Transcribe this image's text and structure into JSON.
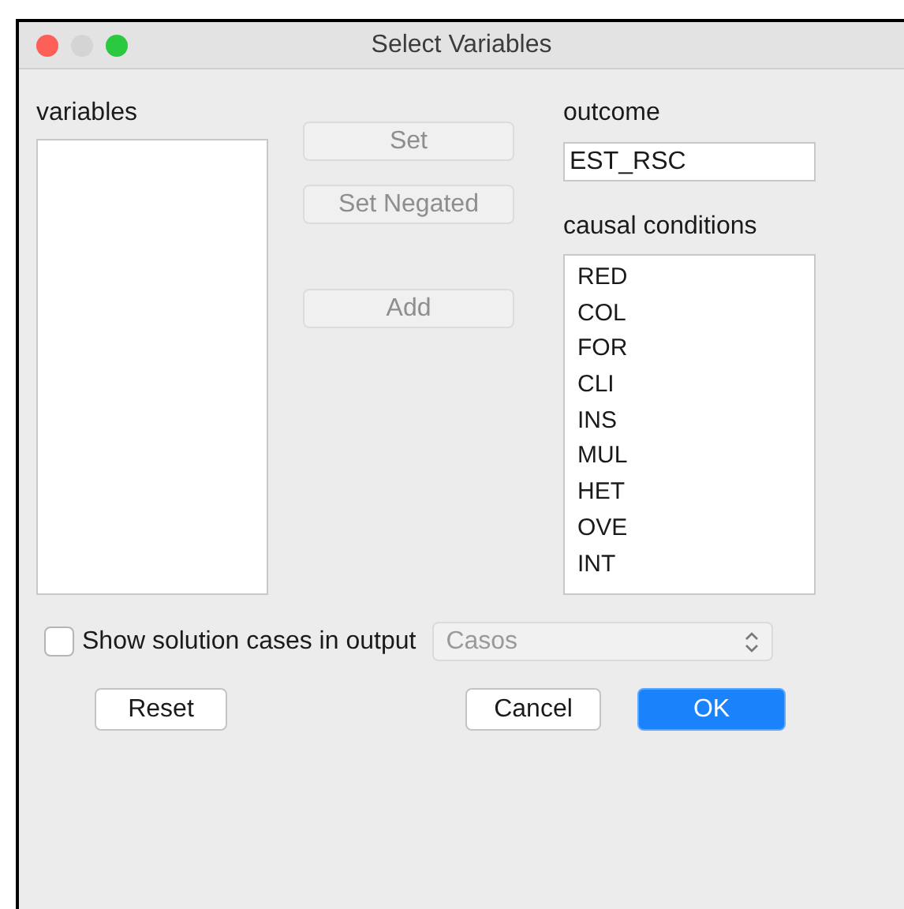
{
  "window": {
    "title": "Select Variables"
  },
  "variables": {
    "label": "variables"
  },
  "buttons": [
    {
      "label": "Set",
      "disabled": true
    },
    {
      "label": "Set Negated",
      "disabled": true
    },
    {
      "label": "Add",
      "disabled": true
    }
  ],
  "outcome": {
    "label": "outcome",
    "value": "EST_RSC"
  },
  "causal_conditions": {
    "label": "causal conditions",
    "items": [
      "RED",
      "COL",
      "FOR",
      "CLI",
      "INS",
      "MUL",
      "HET",
      "OVE",
      "INT"
    ]
  },
  "show_cases": {
    "label": "Show solution cases in output",
    "checked": false
  },
  "case_select": {
    "value": "Casos",
    "disabled": true
  },
  "footer_buttons": [
    {
      "label": "Reset",
      "default": false
    },
    {
      "label": "Cancel",
      "default": false
    },
    {
      "label": "OK",
      "default": true
    }
  ]
}
